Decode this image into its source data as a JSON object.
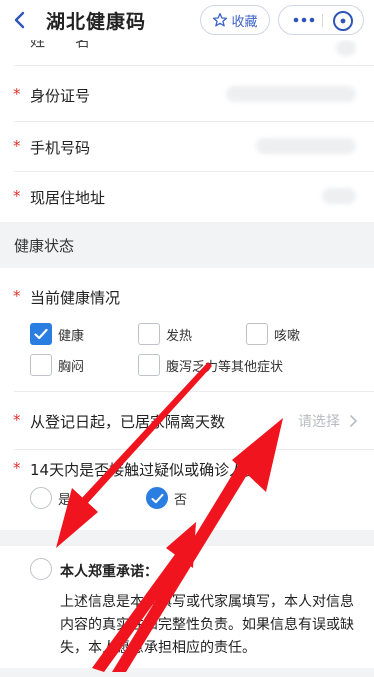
{
  "header": {
    "title": "湖北健康码",
    "favorite_label": "收藏"
  },
  "personal": {
    "name_label": "姓　　名",
    "id_label": "身份证号",
    "phone_label": "手机号码",
    "address_label": "现居住地址",
    "required_mark": "*"
  },
  "health_section": {
    "title": "健康状态",
    "current_label": "当前健康情况",
    "options": [
      {
        "label": "健康",
        "checked": true
      },
      {
        "label": "发热",
        "checked": false
      },
      {
        "label": "咳嗽",
        "checked": false
      },
      {
        "label": "胸闷",
        "checked": false
      },
      {
        "label": "腹泻乏力等其他症状",
        "checked": false
      }
    ],
    "quarantine_label": "从登记日起，已居家隔离天数",
    "quarantine_placeholder": "请选择",
    "contact_label": "14天内是否接触过疑似或确诊人员",
    "contact_yes": "是",
    "contact_no": "否",
    "contact_selected": "否"
  },
  "promise": {
    "label": "本人郑重承诺：",
    "text": "上述信息是本人填写或代家属填写，本人对信息内容的真实性和完整性负责。如果信息有误或缺失，本人愿意承担相应的责任。"
  },
  "colors": {
    "accent": "#2a7de1",
    "required": "#e0312b",
    "arrow": "#f0141e",
    "section_bg": "#f2f3f5"
  }
}
